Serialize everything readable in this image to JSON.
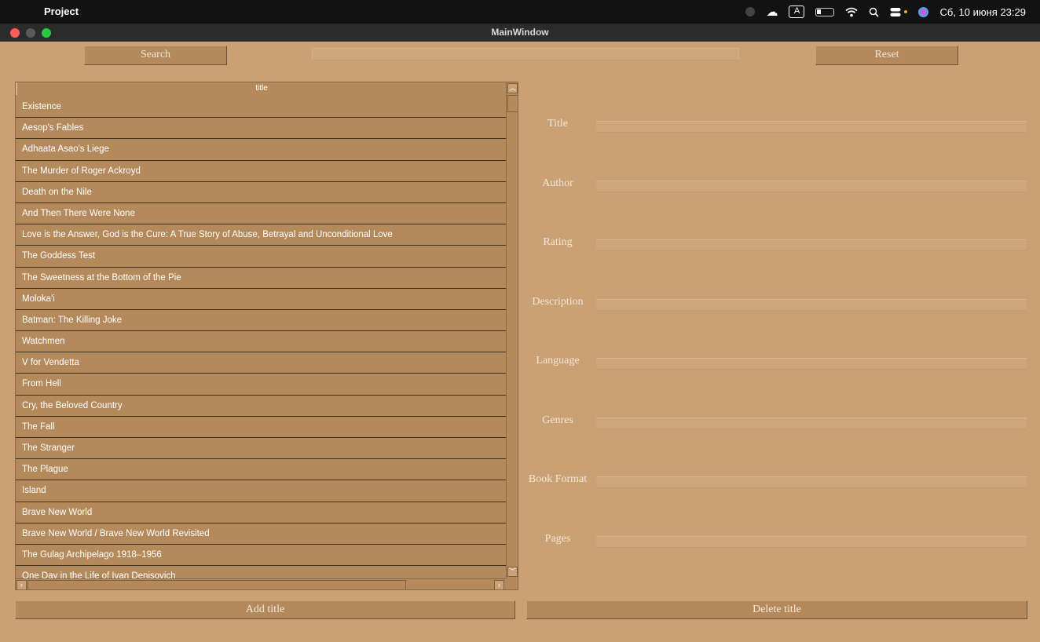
{
  "menubar": {
    "app_name": "Project",
    "clock": "Сб, 10 июня 23:29",
    "keyboard_layout": "A"
  },
  "window": {
    "title": "MainWindow"
  },
  "toolbar": {
    "search_label": "Search",
    "reset_label": "Reset",
    "search_value": ""
  },
  "table": {
    "header": "title",
    "rows": [
      "Existence",
      "Aesop's Fables",
      "Adhaata Asao's Liege",
      "The Murder of Roger Ackroyd",
      "Death on the Nile",
      "And Then There Were None",
      "Love is the Answer, God is the Cure: A True Story of Abuse, Betrayal and Unconditional Love",
      "The Goddess Test",
      "The Sweetness at the Bottom of the Pie",
      "Moloka'i",
      "Batman: The Killing Joke",
      "Watchmen",
      "V for Vendetta",
      "From Hell",
      "Cry, the Beloved Country",
      "The Fall",
      "The Stranger",
      "The Plague",
      "Island",
      "Brave New World",
      "Brave New World / Brave New World Revisited",
      "The Gulag Archipelago 1918–1956",
      "One Day in the Life of Ivan Denisovich"
    ]
  },
  "form": {
    "title_label": "Title",
    "author_label": "Author",
    "rating_label": "Rating",
    "description_label": "Description",
    "language_label": "Language",
    "genres_label": "Genres",
    "book_format_label": "Book Format",
    "pages_label": "Pages"
  },
  "actions": {
    "add_label": "Add title",
    "delete_label": "Delete title"
  },
  "colors": {
    "window_bg": "#c9a175",
    "widget_bg": "#b48a5c",
    "menubar_bg": "#121212",
    "titlebar_bg": "#2b2b2b"
  }
}
